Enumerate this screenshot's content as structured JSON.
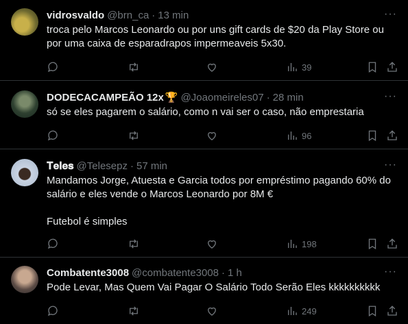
{
  "tweets": [
    {
      "name": "vidrosvaldo",
      "handle": "@brn_ca",
      "time": "13 min",
      "text": "troca pelo Marcos Leonardo ou por uns gift cards de $20 da Play Store ou por uma caixa de esparadrapos impermeaveis 5x30.",
      "views": "39",
      "avatar_color": "#7a6a2a"
    },
    {
      "name": "DODECACAMPEÃO 12x",
      "name_emoji": "🏆",
      "handle": "@Joaomeireles07",
      "time": "28 min",
      "text": "só se eles pagarem o salário, como n vai ser o caso, não emprestaria",
      "views": "96",
      "avatar_color": "#3a4a3a"
    },
    {
      "name": "𝐓𝐞𝐥𝐞𝐬",
      "handle": "@Telesepz",
      "time": "57 min",
      "text": "Mandamos Jorge, Atuesta e Garcia todos por empréstimo pagando 60% do salário e eles vende o Marcos Leonardo por 8M €\n\nFutebol é simples",
      "views": "198",
      "avatar_color": "#b9c6d8"
    },
    {
      "name": "Combatente3008",
      "handle": "@combatente3008",
      "time": "1 h",
      "text": "Pode Levar, Mas Quem Vai Pagar O Salário Todo Serão Eles kkkkkkkkkk",
      "views": "249",
      "avatar_color": "#6b5a50"
    }
  ],
  "dot": "·",
  "more": "···",
  "icons": [
    "reply-icon",
    "retweet-icon",
    "like-icon",
    "views-icon",
    "bookmark-icon",
    "share-icon",
    "more-icon"
  ]
}
